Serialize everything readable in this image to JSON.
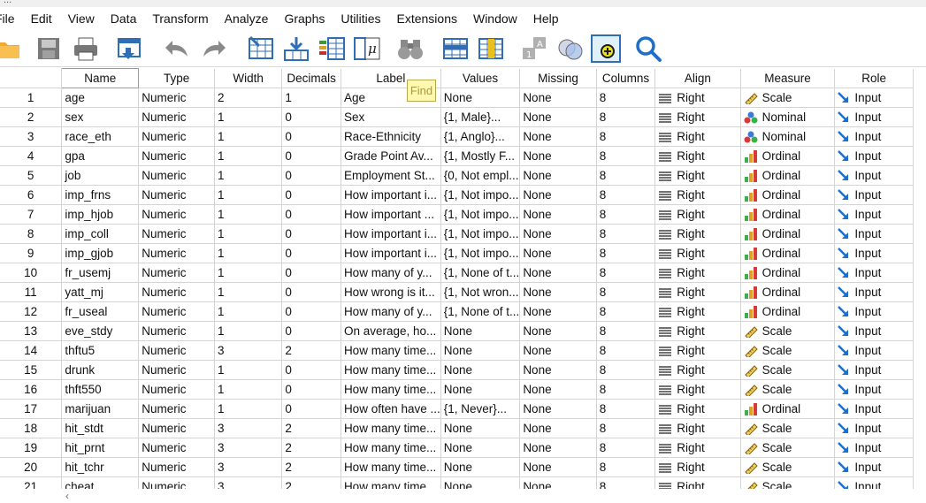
{
  "window": {
    "title_fragment": "..."
  },
  "menus": [
    "File",
    "Edit",
    "View",
    "Data",
    "Transform",
    "Analyze",
    "Graphs",
    "Utilities",
    "Extensions",
    "Window",
    "Help"
  ],
  "toolbar": {
    "buttons": [
      "open-icon",
      "save-icon",
      "print-icon",
      "recall-dialog-icon",
      "undo-icon",
      "redo-icon",
      "goto-case-icon",
      "goto-variable-icon",
      "variables-icon",
      "run-descriptives-icon",
      "find-icon",
      "insert-cases-icon",
      "insert-variable-icon",
      "split-file-icon",
      "select-cases-icon",
      "value-labels-icon",
      "use-sets-icon",
      "search-icon"
    ]
  },
  "tooltip": "Find",
  "columns": [
    "",
    "Name",
    "Type",
    "Width",
    "Decimals",
    "Label",
    "Values",
    "Missing",
    "Columns",
    "Align",
    "Measure",
    "Role"
  ],
  "rows": [
    {
      "n": "1",
      "name": "age",
      "type": "Numeric",
      "width": "2",
      "dec": "1",
      "label": "Age",
      "values": "None",
      "missing": "None",
      "cols": "8",
      "align": "Right",
      "measure": "Scale",
      "role": "Input"
    },
    {
      "n": "2",
      "name": "sex",
      "type": "Numeric",
      "width": "1",
      "dec": "0",
      "label": "Sex",
      "values": "{1, Male}...",
      "missing": "None",
      "cols": "8",
      "align": "Right",
      "measure": "Nominal",
      "role": "Input"
    },
    {
      "n": "3",
      "name": "race_eth",
      "type": "Numeric",
      "width": "1",
      "dec": "0",
      "label": "Race-Ethnicity",
      "values": "{1, Anglo}...",
      "missing": "None",
      "cols": "8",
      "align": "Right",
      "measure": "Nominal",
      "role": "Input"
    },
    {
      "n": "4",
      "name": "gpa",
      "type": "Numeric",
      "width": "1",
      "dec": "0",
      "label": "Grade Point Av...",
      "values": "{1, Mostly F...",
      "missing": "None",
      "cols": "8",
      "align": "Right",
      "measure": "Ordinal",
      "role": "Input"
    },
    {
      "n": "5",
      "name": "job",
      "type": "Numeric",
      "width": "1",
      "dec": "0",
      "label": "Employment St...",
      "values": "{0, Not empl...",
      "missing": "None",
      "cols": "8",
      "align": "Right",
      "measure": "Ordinal",
      "role": "Input"
    },
    {
      "n": "6",
      "name": "imp_frns",
      "type": "Numeric",
      "width": "1",
      "dec": "0",
      "label": "How important i...",
      "values": "{1, Not impo...",
      "missing": "None",
      "cols": "8",
      "align": "Right",
      "measure": "Ordinal",
      "role": "Input"
    },
    {
      "n": "7",
      "name": "imp_hjob",
      "type": "Numeric",
      "width": "1",
      "dec": "0",
      "label": "How important ...",
      "values": "{1, Not impo...",
      "missing": "None",
      "cols": "8",
      "align": "Right",
      "measure": "Ordinal",
      "role": "Input"
    },
    {
      "n": "8",
      "name": "imp_coll",
      "type": "Numeric",
      "width": "1",
      "dec": "0",
      "label": "How important i...",
      "values": "{1, Not impo...",
      "missing": "None",
      "cols": "8",
      "align": "Right",
      "measure": "Ordinal",
      "role": "Input"
    },
    {
      "n": "9",
      "name": "imp_gjob",
      "type": "Numeric",
      "width": "1",
      "dec": "0",
      "label": "How important i...",
      "values": "{1, Not impo...",
      "missing": "None",
      "cols": "8",
      "align": "Right",
      "measure": "Ordinal",
      "role": "Input"
    },
    {
      "n": "10",
      "name": "fr_usemj",
      "type": "Numeric",
      "width": "1",
      "dec": "0",
      "label": "How many of y...",
      "values": "{1, None of t...",
      "missing": "None",
      "cols": "8",
      "align": "Right",
      "measure": "Ordinal",
      "role": "Input"
    },
    {
      "n": "11",
      "name": "yatt_mj",
      "type": "Numeric",
      "width": "1",
      "dec": "0",
      "label": "How wrong is it...",
      "values": "{1, Not wron...",
      "missing": "None",
      "cols": "8",
      "align": "Right",
      "measure": "Ordinal",
      "role": "Input"
    },
    {
      "n": "12",
      "name": "fr_useal",
      "type": "Numeric",
      "width": "1",
      "dec": "0",
      "label": "How many of y...",
      "values": "{1, None of t...",
      "missing": "None",
      "cols": "8",
      "align": "Right",
      "measure": "Ordinal",
      "role": "Input"
    },
    {
      "n": "13",
      "name": "eve_stdy",
      "type": "Numeric",
      "width": "1",
      "dec": "0",
      "label": "On average, ho...",
      "values": "None",
      "missing": "None",
      "cols": "8",
      "align": "Right",
      "measure": "Scale",
      "role": "Input"
    },
    {
      "n": "14",
      "name": "thftu5",
      "type": "Numeric",
      "width": "3",
      "dec": "2",
      "label": "How many time...",
      "values": "None",
      "missing": "None",
      "cols": "8",
      "align": "Right",
      "measure": "Scale",
      "role": "Input"
    },
    {
      "n": "15",
      "name": "drunk",
      "type": "Numeric",
      "width": "1",
      "dec": "0",
      "label": "How many time...",
      "values": "None",
      "missing": "None",
      "cols": "8",
      "align": "Right",
      "measure": "Scale",
      "role": "Input"
    },
    {
      "n": "16",
      "name": "thft550",
      "type": "Numeric",
      "width": "1",
      "dec": "0",
      "label": "How many time...",
      "values": "None",
      "missing": "None",
      "cols": "8",
      "align": "Right",
      "measure": "Scale",
      "role": "Input"
    },
    {
      "n": "17",
      "name": "marijuan",
      "type": "Numeric",
      "width": "1",
      "dec": "0",
      "label": "How often have ...",
      "values": "{1, Never}...",
      "missing": "None",
      "cols": "8",
      "align": "Right",
      "measure": "Ordinal",
      "role": "Input"
    },
    {
      "n": "18",
      "name": "hit_stdt",
      "type": "Numeric",
      "width": "3",
      "dec": "2",
      "label": "How many time...",
      "values": "None",
      "missing": "None",
      "cols": "8",
      "align": "Right",
      "measure": "Scale",
      "role": "Input"
    },
    {
      "n": "19",
      "name": "hit_prnt",
      "type": "Numeric",
      "width": "3",
      "dec": "2",
      "label": "How many time...",
      "values": "None",
      "missing": "None",
      "cols": "8",
      "align": "Right",
      "measure": "Scale",
      "role": "Input"
    },
    {
      "n": "20",
      "name": "hit_tchr",
      "type": "Numeric",
      "width": "3",
      "dec": "2",
      "label": "How many time...",
      "values": "None",
      "missing": "None",
      "cols": "8",
      "align": "Right",
      "measure": "Scale",
      "role": "Input"
    },
    {
      "n": "21",
      "name": "cheat",
      "type": "Numeric",
      "width": "3",
      "dec": "2",
      "label": "How many time...",
      "values": "None",
      "missing": "None",
      "cols": "8",
      "align": "Right",
      "measure": "Scale",
      "role": "Input"
    }
  ],
  "colors": {
    "header_border": "#d4d4d4",
    "tooltip_bg": "#fff8b0",
    "accent_blue": "#1f6fc9"
  }
}
